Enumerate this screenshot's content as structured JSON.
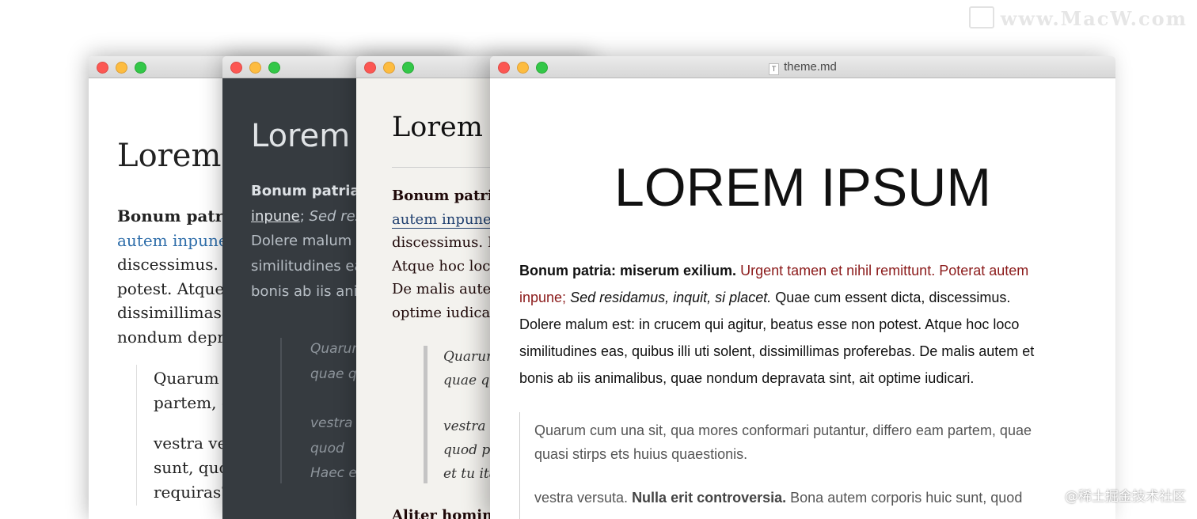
{
  "watermark": {
    "left": "www.MacW.com",
    "right": "@稀土掘金技术社区"
  },
  "windows": {
    "w1": {
      "heading": "Lorem",
      "lines": [
        "Bonum patria",
        "autem inpune",
        "discessimus. D",
        "potest. Atque",
        "dissimillimas",
        "nondum depr"
      ],
      "quote_lines": [
        "Quarum",
        "partem, q",
        "vestra ve",
        "sunt, quo",
        "requiras?"
      ]
    },
    "w2": {
      "heading": "Lorem",
      "line1_bold": "Bonum patria:",
      "line2_link": "inpune",
      "line2_punct": ";",
      "line2_em": "Sed res",
      "lines": [
        "Dolere malum e",
        "similitudines ea",
        "bonis ab iis ani"
      ],
      "quote_lines": [
        "Quarum",
        "quae q",
        "vestra",
        "quod",
        "Haec e"
      ]
    },
    "w3": {
      "heading": "Lorem i",
      "line1_bold": "Bonum patria",
      "line2_link": "autem inpune",
      "lines": [
        "discessimus. D",
        "Atque hoc loco",
        "De malis auten",
        "optime iudicar"
      ],
      "quote_lines": [
        "Quarum",
        "quae qu",
        "vestra v",
        "quod pe",
        "et tu ita"
      ],
      "bottom": "Aliter homine"
    },
    "w4": {
      "title": "theme.md",
      "doc_icon": "T",
      "heading": "LOREM IPSUM",
      "p1": {
        "bold": "Bonum patria: miserum exilium.",
        "red1": "Urgent tamen et nihil remittunt. Poterat autem",
        "red2": "inpune;",
        "em": "Sed residamus, inquit, si placet.",
        "line2_rest": "Quae cum essent dicta, discessimus.",
        "line3": "Dolere malum est: in crucem qui agitur, beatus esse non potest. Atque hoc loco",
        "line4": "similitudines eas, quibus illi uti solent, dissimillimas proferebas. De malis autem et",
        "line5": "bonis ab iis animalibus, quae nondum depravata sint, ait optime iudicari."
      },
      "quote": {
        "line1": "Quarum cum una sit, qua mores conformari putantur, differo eam partem, quae",
        "line2": "quasi stirps ets huius quaestionis.",
        "line3_start": "vestra versuta.",
        "line3_bold": "Nulla erit controversia.",
        "line3_end": "Bona autem corporis huic sunt, quod"
      }
    }
  },
  "colors": {
    "accent_red": "#8b1a1a",
    "link_blue": "#2f6eaa",
    "night_bg": "#363b40",
    "pixyll_bg": "#f3f2ee",
    "traffic_close": "#fc5753",
    "traffic_min": "#fdbc40",
    "traffic_max": "#33c748"
  }
}
